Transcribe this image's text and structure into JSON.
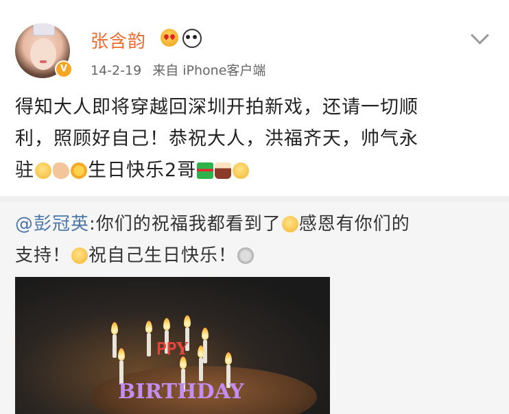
{
  "post": {
    "username": "张含韵",
    "date": "14-2-19",
    "source": "来自 iPhone客户端",
    "verified_badge": "V",
    "username_emojis": [
      "love-eyes-icon",
      "panda-icon"
    ],
    "content_lines": [
      "得知大人即将穿越回深圳开拍新戏，还请一切顺",
      "利，照顾好自己！恭祝大人，洪福齐天，帅气永",
      "驻",
      "生日快乐2哥"
    ]
  },
  "repost": {
    "mention": "@彭冠英",
    "text_1": ":你们的祝福我都看到了",
    "text_2": "感恩有你们的",
    "text_3": "支持！",
    "text_4": "祝自己生日快乐！",
    "photo_alt_letters": "HAPPY BIRTHDAY"
  },
  "colors": {
    "username": "#f06a2d",
    "mention": "#4a76a8",
    "repost_bg": "#f5f5f5"
  }
}
